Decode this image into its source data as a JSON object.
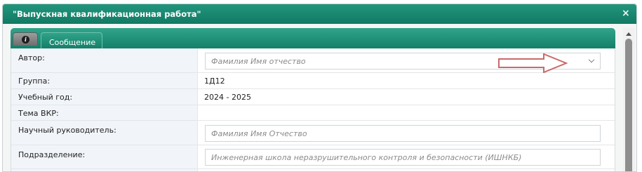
{
  "dialog": {
    "title": "\"Выпускная квалификационная работа\"",
    "close_symbol": "×"
  },
  "tabs": {
    "info_icon": "info-icon",
    "info_glyph": "i",
    "message_label": "Сообщение"
  },
  "form": {
    "author": {
      "label": "Автор:",
      "placeholder": "Фамилия Имя отчество"
    },
    "group": {
      "label": "Группа:",
      "value": "1Д12"
    },
    "year": {
      "label": "Учебный год:",
      "value": "2024 - 2025"
    },
    "topic": {
      "label": "Тема ВКР:",
      "value": ""
    },
    "supervisor": {
      "label": "Научный руководитель:",
      "placeholder": "Фамилия Имя Отчество"
    },
    "department": {
      "label": "Подразделение:",
      "placeholder": "Инженерная школа неразрушительного контроля и безопасности (ИШНКБ)"
    }
  },
  "colors": {
    "header_green": "#1a8a71",
    "label_bg": "#f1f4f9",
    "annotation_arrow": "#c96a6a"
  }
}
